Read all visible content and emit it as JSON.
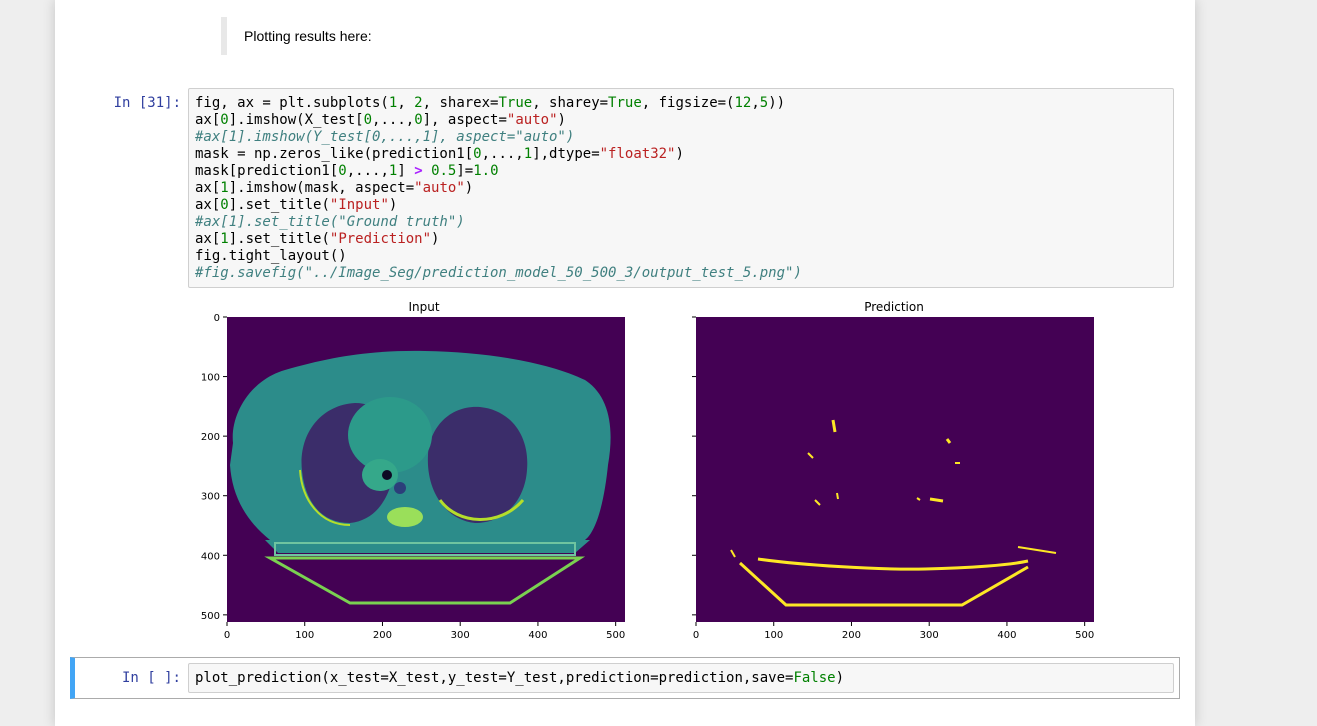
{
  "markdown": {
    "text": "Plotting results here:"
  },
  "cell1": {
    "prompt": "In [31]:",
    "lines": [
      [
        {
          "t": "fig, ax = plt.subplots(",
          "c": ""
        },
        {
          "t": "1",
          "c": "num"
        },
        {
          "t": ", ",
          "c": ""
        },
        {
          "t": "2",
          "c": "num"
        },
        {
          "t": ", sharex=",
          "c": ""
        },
        {
          "t": "True",
          "c": "kw"
        },
        {
          "t": ", sharey=",
          "c": ""
        },
        {
          "t": "True",
          "c": "kw"
        },
        {
          "t": ", figsize=(",
          "c": ""
        },
        {
          "t": "12",
          "c": "num"
        },
        {
          "t": ",",
          "c": ""
        },
        {
          "t": "5",
          "c": "num"
        },
        {
          "t": "))",
          "c": ""
        }
      ],
      [
        {
          "t": "ax[",
          "c": ""
        },
        {
          "t": "0",
          "c": "num"
        },
        {
          "t": "].imshow(X_test[",
          "c": ""
        },
        {
          "t": "0",
          "c": "num"
        },
        {
          "t": ",...,",
          "c": ""
        },
        {
          "t": "0",
          "c": "num"
        },
        {
          "t": "], aspect=",
          "c": ""
        },
        {
          "t": "\"auto\"",
          "c": "str"
        },
        {
          "t": ")",
          "c": ""
        }
      ],
      [
        {
          "t": "#ax[1].imshow(Y_test[0,...,1], aspect=\"auto\")",
          "c": "cmt"
        }
      ],
      [
        {
          "t": "mask = np.zeros_like(prediction1[",
          "c": ""
        },
        {
          "t": "0",
          "c": "num"
        },
        {
          "t": ",...,",
          "c": ""
        },
        {
          "t": "1",
          "c": "num"
        },
        {
          "t": "],dtype=",
          "c": ""
        },
        {
          "t": "\"float32\"",
          "c": "str"
        },
        {
          "t": ")",
          "c": ""
        }
      ],
      [
        {
          "t": "mask[prediction1[",
          "c": ""
        },
        {
          "t": "0",
          "c": "num"
        },
        {
          "t": ",...,",
          "c": ""
        },
        {
          "t": "1",
          "c": "num"
        },
        {
          "t": "] ",
          "c": ""
        },
        {
          "t": ">",
          "c": "op"
        },
        {
          "t": " ",
          "c": ""
        },
        {
          "t": "0.5",
          "c": "num"
        },
        {
          "t": "]=",
          "c": ""
        },
        {
          "t": "1.0",
          "c": "num"
        }
      ],
      [
        {
          "t": "ax[",
          "c": ""
        },
        {
          "t": "1",
          "c": "num"
        },
        {
          "t": "].imshow(mask, aspect=",
          "c": ""
        },
        {
          "t": "\"auto\"",
          "c": "str"
        },
        {
          "t": ")",
          "c": ""
        }
      ],
      [
        {
          "t": "ax[",
          "c": ""
        },
        {
          "t": "0",
          "c": "num"
        },
        {
          "t": "].set_title(",
          "c": ""
        },
        {
          "t": "\"Input\"",
          "c": "str"
        },
        {
          "t": ")",
          "c": ""
        }
      ],
      [
        {
          "t": "#ax[1].set_title(\"Ground truth\")",
          "c": "cmt"
        }
      ],
      [
        {
          "t": "ax[",
          "c": ""
        },
        {
          "t": "1",
          "c": "num"
        },
        {
          "t": "].set_title(",
          "c": ""
        },
        {
          "t": "\"Prediction\"",
          "c": "str"
        },
        {
          "t": ")",
          "c": ""
        }
      ],
      [
        {
          "t": "fig.tight_layout()",
          "c": ""
        }
      ],
      [
        {
          "t": "#fig.savefig(\"../Image_Seg/prediction_model_50_500_3/output_test_5.png\")",
          "c": "cmt"
        }
      ]
    ]
  },
  "figure": {
    "left_title": "Input",
    "right_title": "Prediction",
    "y_ticks": [
      "0",
      "100",
      "200",
      "300",
      "400",
      "500"
    ],
    "x_ticks": [
      "0",
      "100",
      "200",
      "300",
      "400",
      "500"
    ],
    "colors": {
      "background": "#440154",
      "tissue": "#2c8c8a",
      "dark_lung": "#3b2d6a",
      "bright": "#b5de2b",
      "mask": "#fde725"
    }
  },
  "cell2": {
    "prompt": "In [ ]:",
    "lines": [
      [
        {
          "t": "plot_prediction(x_test=X_test,y_test=Y_test,prediction=prediction,save=",
          "c": ""
        },
        {
          "t": "False",
          "c": "kw"
        },
        {
          "t": ")",
          "c": ""
        }
      ]
    ]
  }
}
